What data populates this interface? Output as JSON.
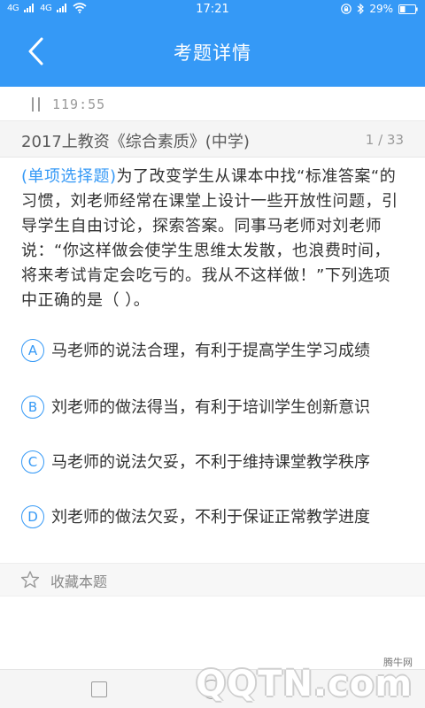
{
  "status_bar": {
    "sim1": "4G",
    "sim2": "4G",
    "time": "17:21",
    "battery": "29%"
  },
  "header": {
    "title": "考题详情"
  },
  "timer": {
    "value": "119:55"
  },
  "exam": {
    "name": "2017上教资《综合素质》(中学)",
    "progress": "1 / 33"
  },
  "question": {
    "type": "(单项选择题)",
    "text": "为了改变学生从课本中找“标准答案“的习惯，刘老师经常在课堂上设计一些开放性问题，引导学生自由讨论，探索答案。同事马老师对刘老师说：“你这样做会使学生思维太发散，也浪费时间，将来考试肯定会吃亏的。我从不这样做！”下列选项中正确的是（    ）。"
  },
  "options": [
    {
      "letter": "A",
      "text": "马老师的说法合理，有利于提高学生学习成绩"
    },
    {
      "letter": "B",
      "text": "刘老师的做法得当，有利于培训学生创新意识"
    },
    {
      "letter": "C",
      "text": "马老师的说法欠妥，不利于维持课堂教学秩序"
    },
    {
      "letter": "D",
      "text": "刘老师的做法欠妥，不利于保证正常教学进度"
    }
  ],
  "favorite": {
    "label": "收藏本题"
  },
  "watermark": {
    "small": "腾牛网",
    "big": "QQTN.com"
  },
  "colors": {
    "accent": "#3599f6",
    "text": "#333333",
    "muted": "#9a9a9a"
  },
  "icons": {
    "back": "chevron-left-icon",
    "pause": "pause-icon",
    "favorite": "star-outline-icon"
  }
}
